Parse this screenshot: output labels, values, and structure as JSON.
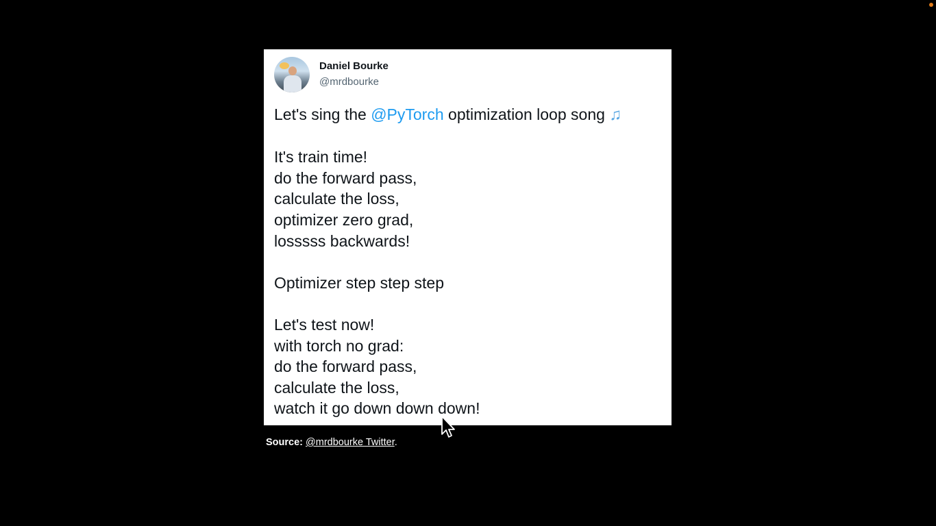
{
  "tweet": {
    "author_name": "Daniel Bourke",
    "author_handle": "@mrdbourke",
    "intro_prefix": "Let's sing the ",
    "intro_mention": "@PyTorch",
    "intro_suffix": " optimization loop song ",
    "music_icon": "musical-notes-icon",
    "lines": [
      "It's train time!",
      "do the forward pass,",
      "calculate the loss,",
      "optimizer zero grad,",
      "losssss backwards!",
      "",
      "Optimizer step step step",
      "",
      "Let's test now!",
      "with torch no grad:",
      "do the forward pass,",
      "calculate the loss,",
      "watch it go down down down!"
    ]
  },
  "source": {
    "label": "Source:",
    "link_text": "@mrdbourke Twitter",
    "suffix": "."
  },
  "colors": {
    "background": "#000000",
    "card": "#ffffff",
    "mention": "#1d9bf0",
    "indicator_dot": "#e07b1a"
  }
}
